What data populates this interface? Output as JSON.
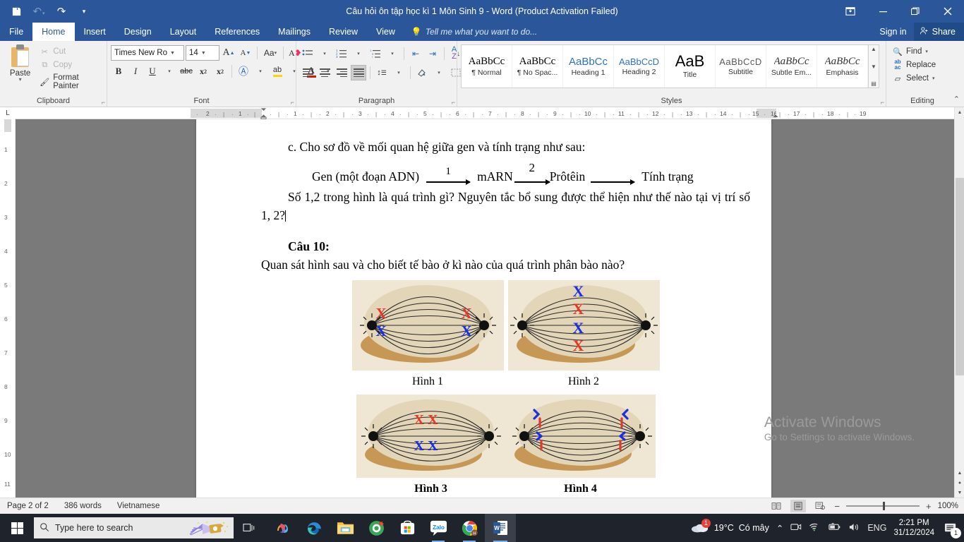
{
  "window": {
    "title": "Câu hỏi ôn tập học kì 1 Môn Sinh 9 - Word (Product Activation Failed)",
    "quick_access": {
      "save": "save-icon",
      "undo": "undo-icon",
      "redo": "redo-icon",
      "customize": "customize-qat-icon"
    },
    "controls": {
      "ribbon_display": "▣",
      "minimize": "—",
      "restore": "❐",
      "close": "✕"
    }
  },
  "ribbon_tabs": [
    {
      "label": "File",
      "active": false
    },
    {
      "label": "Home",
      "active": true
    },
    {
      "label": "Insert",
      "active": false
    },
    {
      "label": "Design",
      "active": false
    },
    {
      "label": "Layout",
      "active": false
    },
    {
      "label": "References",
      "active": false
    },
    {
      "label": "Mailings",
      "active": false
    },
    {
      "label": "Review",
      "active": false
    },
    {
      "label": "View",
      "active": false
    }
  ],
  "tell_me": "Tell me what you want to do...",
  "account": {
    "sign_in": "Sign in",
    "share": "Share"
  },
  "ribbon": {
    "clipboard": {
      "group_label": "Clipboard",
      "paste_label": "Paste",
      "items": [
        {
          "label": "Cut",
          "icon": "scissors-icon",
          "enabled": false
        },
        {
          "label": "Copy",
          "icon": "copy-icon",
          "enabled": false
        },
        {
          "label": "Format Painter",
          "icon": "format-painter-icon",
          "enabled": true
        }
      ]
    },
    "font": {
      "group_label": "Font",
      "font_name": "Times New Ro",
      "font_size": "14",
      "buttons": [
        {
          "name": "grow-font",
          "glyph": "A"
        },
        {
          "name": "shrink-font",
          "glyph": "A"
        },
        {
          "name": "change-case",
          "glyph": "Aa"
        },
        {
          "name": "clear-formatting",
          "glyph": "A"
        },
        {
          "name": "bold",
          "glyph": "B"
        },
        {
          "name": "italic",
          "glyph": "I"
        },
        {
          "name": "underline",
          "glyph": "U"
        },
        {
          "name": "strikethrough",
          "glyph": "abc"
        },
        {
          "name": "subscript",
          "glyph": "x₂"
        },
        {
          "name": "superscript",
          "glyph": "x²"
        },
        {
          "name": "text-effects",
          "glyph": "A"
        },
        {
          "name": "text-highlight",
          "glyph": "ab"
        },
        {
          "name": "font-color",
          "glyph": "A"
        }
      ]
    },
    "paragraph": {
      "group_label": "Paragraph",
      "buttons": [
        {
          "name": "bullets",
          "glyph": "☰"
        },
        {
          "name": "numbering",
          "glyph": "☰"
        },
        {
          "name": "multilevel-list",
          "glyph": "☰"
        },
        {
          "name": "decrease-indent",
          "glyph": "⇤"
        },
        {
          "name": "increase-indent",
          "glyph": "⇥"
        },
        {
          "name": "sort",
          "glyph": "A↓"
        },
        {
          "name": "show-formatting-marks",
          "glyph": "¶"
        },
        {
          "name": "align-left",
          "glyph": ""
        },
        {
          "name": "align-center",
          "glyph": ""
        },
        {
          "name": "align-right",
          "glyph": ""
        },
        {
          "name": "justify",
          "glyph": ""
        },
        {
          "name": "line-spacing",
          "glyph": "↕"
        },
        {
          "name": "shading",
          "glyph": "▨"
        },
        {
          "name": "borders",
          "glyph": "⊞"
        }
      ]
    },
    "styles": {
      "group_label": "Styles",
      "items": [
        {
          "preview": "AaBbCc",
          "name": "¶ Normal",
          "kind": "serif"
        },
        {
          "preview": "AaBbCc",
          "name": "¶ No Spac...",
          "kind": "serif"
        },
        {
          "preview": "AaBbCc",
          "name": "Heading 1",
          "kind": "blue"
        },
        {
          "preview": "AaBbCcD",
          "name": "Heading 2",
          "kind": "blue-small"
        },
        {
          "preview": "AaB",
          "name": "Title",
          "kind": "title"
        },
        {
          "preview": "AaBbCcD",
          "name": "Subtitle",
          "kind": "subtitle"
        },
        {
          "preview": "AaBbCc",
          "name": "Subtle Em...",
          "kind": "emphasis"
        },
        {
          "preview": "AaBbCc",
          "name": "Emphasis",
          "kind": "emphasis"
        }
      ]
    },
    "editing": {
      "group_label": "Editing",
      "items": [
        {
          "label": "Find",
          "icon": "search-icon",
          "caret": true
        },
        {
          "label": "Replace",
          "icon": "replace-icon",
          "caret": false
        },
        {
          "label": "Select",
          "icon": "select-icon",
          "caret": true
        }
      ]
    }
  },
  "ruler": {
    "left_labels": [
      "2",
      "1"
    ],
    "labels": [
      "1",
      "2",
      "3",
      "4",
      "5",
      "6",
      "7",
      "8",
      "9",
      "10",
      "11",
      "12",
      "13",
      "14",
      "15",
      "16",
      "17",
      "18",
      "19"
    ]
  },
  "vruler": {
    "labels": [
      "1",
      "2",
      "3",
      "4",
      "5",
      "6",
      "7",
      "8",
      "9",
      "10",
      "11"
    ]
  },
  "document": {
    "line_c": "c. Cho sơ đồ về mối quan hệ giữa gen và tính trạng như sau:",
    "diagram": {
      "gen": "Gen (một đoạn ADN)",
      "arrow1_label": "1",
      "mrna": "mARN",
      "arrow2_label": "2",
      "protein": "Prôtêin",
      "trait": "Tính trạng"
    },
    "question_c": "Số 1,2 trong hình là quá trình gì? Nguyên tắc bổ sung được thể hiện như thế nào tại vị trí số 1, 2?",
    "cau10_heading": "Câu 10:",
    "cau10_text": "Quan sát hình sau và cho biết tế bào ở kì nào của quá trình phân bào nào?",
    "figures": [
      {
        "caption": "Hình 1",
        "bold": false
      },
      {
        "caption": "Hình 2",
        "bold": false
      },
      {
        "caption": "Hình 3",
        "bold": true
      },
      {
        "caption": "Hình 4",
        "bold": true
      }
    ]
  },
  "watermark": {
    "line1": "Activate Windows",
    "line2": "Go to Settings to activate Windows."
  },
  "status_bar": {
    "page": "Page 2 of 2",
    "words": "386 words",
    "language": "Vietnamese",
    "views": [
      {
        "name": "read-mode",
        "active": false
      },
      {
        "name": "print-layout",
        "active": true
      },
      {
        "name": "web-layout",
        "active": false
      }
    ],
    "zoom_out": "−",
    "zoom_in": "+",
    "zoom_level": "100%"
  },
  "taskbar": {
    "search_placeholder": "Type here to search",
    "apps": [
      {
        "name": "copilot",
        "running": false
      },
      {
        "name": "microsoft-edge",
        "running": false
      },
      {
        "name": "file-explorer",
        "running": false
      },
      {
        "name": "coc-coc-browser",
        "running": false
      },
      {
        "name": "microsoft-store",
        "running": false
      },
      {
        "name": "zalo",
        "running": true
      },
      {
        "name": "google-chrome",
        "running": true
      },
      {
        "name": "microsoft-word",
        "running": true,
        "active": true
      }
    ],
    "tray": {
      "weather_temp": "19°C",
      "weather_desc": "Có mây",
      "weather_badge": "1",
      "language": "ENG",
      "time": "2:21 PM",
      "date": "31/12/2024",
      "notification_count": "1"
    }
  },
  "colors": {
    "word_blue": "#2b579a",
    "accent_blue": "#2e74b5",
    "chromosome_red": "#e23a28",
    "chromosome_blue": "#1a2fe0"
  }
}
